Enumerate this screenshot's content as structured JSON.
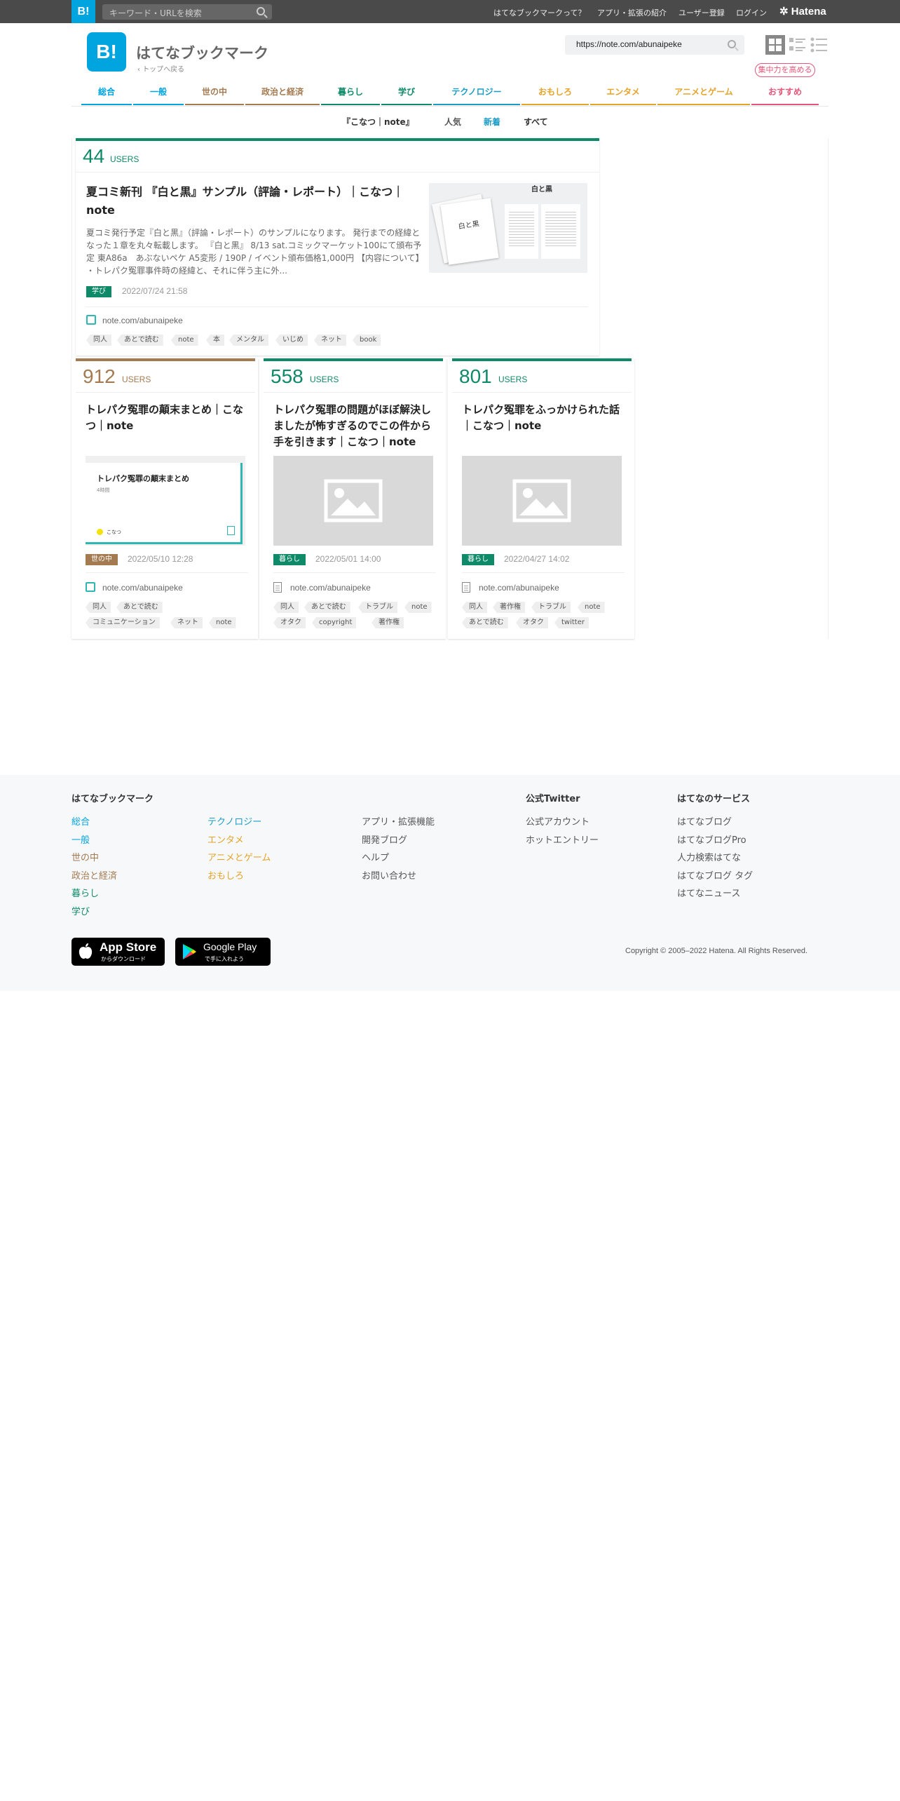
{
  "topbar": {
    "logo": "B!",
    "search_placeholder": "キーワード・URLを検索",
    "links": [
      "はてなブックマークって？",
      "アプリ・拡張の紹介",
      "ユーザー登録",
      "ログイン"
    ],
    "brand": "Hatena"
  },
  "header": {
    "logo": "B!",
    "title": "はてなブックマーク",
    "back_link": "トップへ戻る",
    "url_value": "https://note.com/abunaipeke",
    "focus_button": "集中力を高める"
  },
  "nav": [
    {
      "label": "総合",
      "color": "#00a4de"
    },
    {
      "label": "一般",
      "color": "#00a4de"
    },
    {
      "label": "世の中",
      "color": "#a47a51"
    },
    {
      "label": "政治と経済",
      "color": "#a47a51"
    },
    {
      "label": "暮らし",
      "color": "#0f8a68"
    },
    {
      "label": "学び",
      "color": "#0f8a68"
    },
    {
      "label": "テクノロジー",
      "color": "#1b9cc7"
    },
    {
      "label": "おもしろ",
      "color": "#e5a32a"
    },
    {
      "label": "エンタメ",
      "color": "#e5a32a"
    },
    {
      "label": "アニメとゲーム",
      "color": "#e5a32a"
    },
    {
      "label": "おすすめ",
      "color": "#e5577a"
    }
  ],
  "subnav": {
    "title": "『こなつ｜note』",
    "tabs": [
      "人気",
      "新着",
      "すべて"
    ]
  },
  "main_entry": {
    "users": "44",
    "users_label": "USERS",
    "title": "夏コミ新刊 『白と黒』サンプル（評論・レポート）｜こなつ｜note",
    "description": "夏コミ発行予定『白と黒』（評論・レポート）のサンプルになります。 発行までの経緯となった１章を丸々転載します。 『白と黒』 8/13 sat.コミックマーケット100にて頒布予定 東A86a　あぶないペケ A5変形 / 190P / イベント頒布価格1,000円 【内容について】 ・トレパク冤罪事件時の経緯と、それに伴う主に外...",
    "category": "学び",
    "date": "2022/07/24 21:58",
    "domain": "note.com/abunaipeke",
    "tags": [
      "同人",
      "あとで読む",
      "note",
      "本",
      "メンタル",
      "いじめ",
      "ネット",
      "book"
    ],
    "thumb_title": "白と黒"
  },
  "entries": [
    {
      "users": "912",
      "users_label": "USERS",
      "title": "トレパク冤罪の顛末まとめ｜こなつ｜note",
      "category": "世の中",
      "date": "2022/05/10 12:28",
      "domain": "note.com/abunaipeke",
      "tags": [
        "同人",
        "あとで読む",
        "コミュニケーション",
        "ネット",
        "note"
      ],
      "thumb_title": "トレパク冤罪の顛末まとめ",
      "thumb_meta": "4時間",
      "thumb_author": "こなつ"
    },
    {
      "users": "558",
      "users_label": "USERS",
      "title": "トレパク冤罪の問題がほぼ解決しましたが怖すぎるのでこの件から手を引きます｜こなつ｜note",
      "category": "暮らし",
      "date": "2022/05/01 14:00",
      "domain": "note.com/abunaipeke",
      "tags": [
        "同人",
        "あとで読む",
        "トラブル",
        "note",
        "オタク",
        "copyright",
        "著作権"
      ]
    },
    {
      "users": "801",
      "users_label": "USERS",
      "title": "トレパク冤罪をふっかけられた話｜こなつ｜note",
      "category": "暮らし",
      "date": "2022/04/27 14:02",
      "domain": "note.com/abunaipeke",
      "tags": [
        "同人",
        "著作権",
        "トラブル",
        "note",
        "あとで読む",
        "オタク",
        "twitter"
      ]
    }
  ],
  "footer": {
    "col1_title": "はてなブックマーク",
    "col1_links_a": [
      "総合",
      "一般",
      "世の中",
      "政治と経済",
      "暮らし",
      "学び"
    ],
    "col1_links_b": [
      "テクノロジー",
      "エンタメ",
      "アニメとゲーム",
      "おもしろ"
    ],
    "col2_links": [
      "アプリ・拡張機能",
      "開発ブログ",
      "ヘルプ",
      "お問い合わせ"
    ],
    "col3_title": "公式Twitter",
    "col3_links": [
      "公式アカウント",
      "ホットエントリー"
    ],
    "col4_title": "はてなのサービス",
    "col4_links": [
      "はてなブログ",
      "はてなブログPro",
      "人力検索はてな",
      "はてなブログ タグ",
      "はてなニュース"
    ],
    "app_store": {
      "title": "App Store",
      "sub": "からダウンロード"
    },
    "google_play": {
      "title": "Google Play",
      "sub": "で手に入れよう"
    },
    "copyright": "Copyright © 2005–2022 Hatena. All Rights Reserved."
  }
}
